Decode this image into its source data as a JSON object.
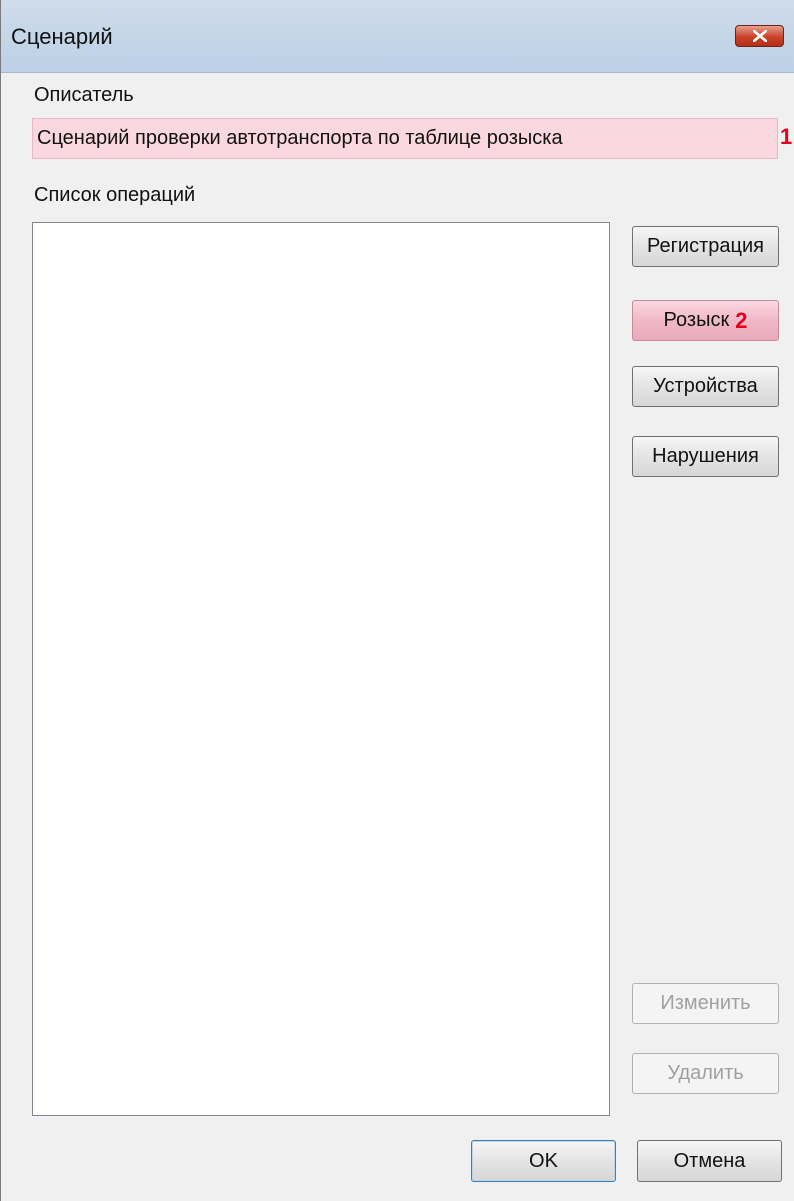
{
  "window": {
    "title": "Сценарий"
  },
  "descriptor": {
    "label": "Описатель",
    "value": "Сценарий проверки автотранспорта по таблице розыска",
    "marker": "1"
  },
  "operations": {
    "label": "Список операций",
    "items": []
  },
  "buttons": {
    "registration": "Регистрация",
    "search": "Розыск",
    "search_marker": "2",
    "devices": "Устройства",
    "violations": "Нарушения",
    "edit": "Изменить",
    "delete": "Удалить",
    "ok": "OK",
    "cancel": "Отмена"
  },
  "colors": {
    "highlight": "#fbd7e0",
    "marker": "#e4001a"
  }
}
